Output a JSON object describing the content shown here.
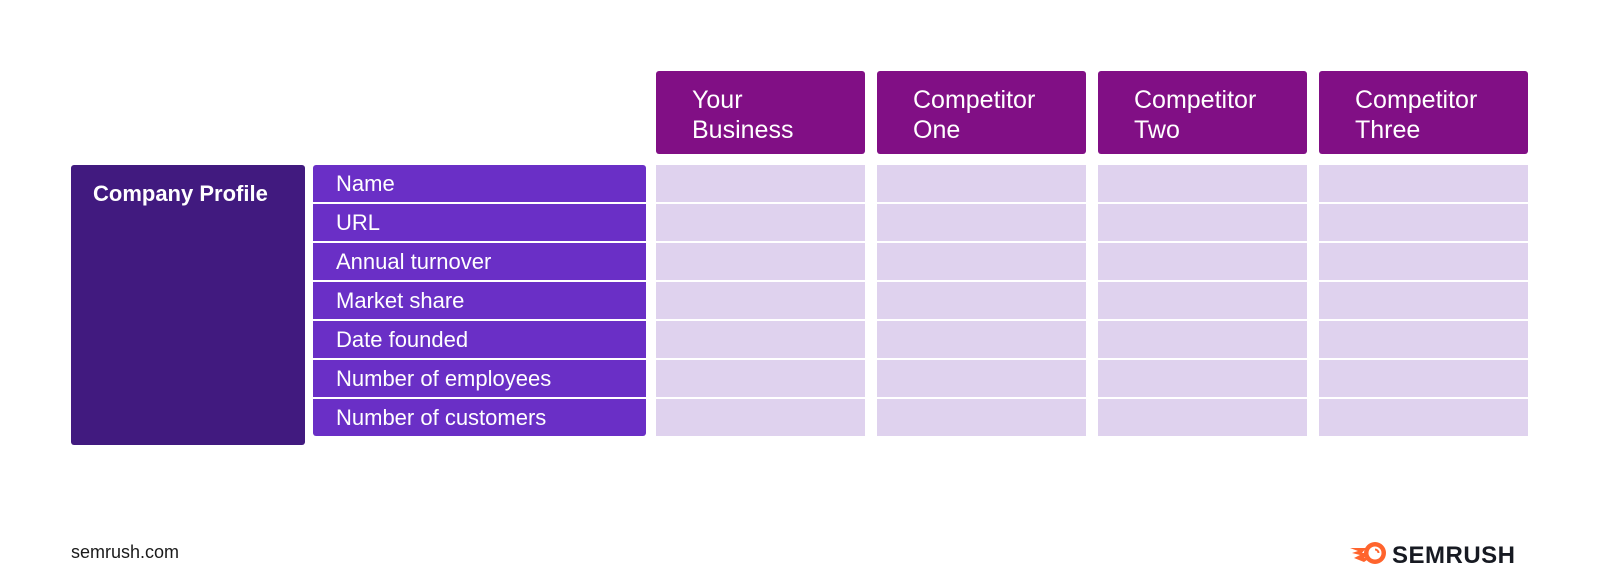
{
  "columns": [
    "Your\nBusiness",
    "Competitor\nOne",
    "Competitor\nTwo",
    "Competitor\nThree"
  ],
  "category": "Company Profile",
  "rows": [
    "Name",
    "URL",
    "Annual turnover",
    "Market share",
    "Date founded",
    "Number of employees",
    "Number of customers"
  ],
  "footer": {
    "source": "semrush.com",
    "brand": "SEMRUSH",
    "brand_icon": "semrush-fireball-icon"
  },
  "colors": {
    "header": "#810f85",
    "category": "#411a7f",
    "row_label": "#6a2fc6",
    "cell": "#dfd2ee",
    "logo_accent": "#ff642d"
  }
}
